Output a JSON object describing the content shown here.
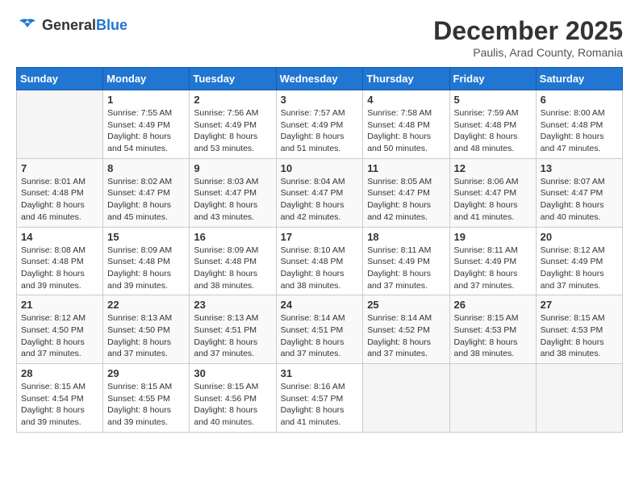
{
  "header": {
    "logo": {
      "general": "General",
      "blue": "Blue"
    },
    "title": "December 2025",
    "subtitle": "Paulis, Arad County, Romania"
  },
  "calendar": {
    "days_of_week": [
      "Sunday",
      "Monday",
      "Tuesday",
      "Wednesday",
      "Thursday",
      "Friday",
      "Saturday"
    ],
    "weeks": [
      [
        {
          "day": "",
          "info": ""
        },
        {
          "day": "1",
          "info": "Sunrise: 7:55 AM\nSunset: 4:49 PM\nDaylight: 8 hours\nand 54 minutes."
        },
        {
          "day": "2",
          "info": "Sunrise: 7:56 AM\nSunset: 4:49 PM\nDaylight: 8 hours\nand 53 minutes."
        },
        {
          "day": "3",
          "info": "Sunrise: 7:57 AM\nSunset: 4:49 PM\nDaylight: 8 hours\nand 51 minutes."
        },
        {
          "day": "4",
          "info": "Sunrise: 7:58 AM\nSunset: 4:48 PM\nDaylight: 8 hours\nand 50 minutes."
        },
        {
          "day": "5",
          "info": "Sunrise: 7:59 AM\nSunset: 4:48 PM\nDaylight: 8 hours\nand 48 minutes."
        },
        {
          "day": "6",
          "info": "Sunrise: 8:00 AM\nSunset: 4:48 PM\nDaylight: 8 hours\nand 47 minutes."
        }
      ],
      [
        {
          "day": "7",
          "info": "Sunrise: 8:01 AM\nSunset: 4:48 PM\nDaylight: 8 hours\nand 46 minutes."
        },
        {
          "day": "8",
          "info": "Sunrise: 8:02 AM\nSunset: 4:47 PM\nDaylight: 8 hours\nand 45 minutes."
        },
        {
          "day": "9",
          "info": "Sunrise: 8:03 AM\nSunset: 4:47 PM\nDaylight: 8 hours\nand 43 minutes."
        },
        {
          "day": "10",
          "info": "Sunrise: 8:04 AM\nSunset: 4:47 PM\nDaylight: 8 hours\nand 42 minutes."
        },
        {
          "day": "11",
          "info": "Sunrise: 8:05 AM\nSunset: 4:47 PM\nDaylight: 8 hours\nand 42 minutes."
        },
        {
          "day": "12",
          "info": "Sunrise: 8:06 AM\nSunset: 4:47 PM\nDaylight: 8 hours\nand 41 minutes."
        },
        {
          "day": "13",
          "info": "Sunrise: 8:07 AM\nSunset: 4:47 PM\nDaylight: 8 hours\nand 40 minutes."
        }
      ],
      [
        {
          "day": "14",
          "info": "Sunrise: 8:08 AM\nSunset: 4:48 PM\nDaylight: 8 hours\nand 39 minutes."
        },
        {
          "day": "15",
          "info": "Sunrise: 8:09 AM\nSunset: 4:48 PM\nDaylight: 8 hours\nand 39 minutes."
        },
        {
          "day": "16",
          "info": "Sunrise: 8:09 AM\nSunset: 4:48 PM\nDaylight: 8 hours\nand 38 minutes."
        },
        {
          "day": "17",
          "info": "Sunrise: 8:10 AM\nSunset: 4:48 PM\nDaylight: 8 hours\nand 38 minutes."
        },
        {
          "day": "18",
          "info": "Sunrise: 8:11 AM\nSunset: 4:49 PM\nDaylight: 8 hours\nand 37 minutes."
        },
        {
          "day": "19",
          "info": "Sunrise: 8:11 AM\nSunset: 4:49 PM\nDaylight: 8 hours\nand 37 minutes."
        },
        {
          "day": "20",
          "info": "Sunrise: 8:12 AM\nSunset: 4:49 PM\nDaylight: 8 hours\nand 37 minutes."
        }
      ],
      [
        {
          "day": "21",
          "info": "Sunrise: 8:12 AM\nSunset: 4:50 PM\nDaylight: 8 hours\nand 37 minutes."
        },
        {
          "day": "22",
          "info": "Sunrise: 8:13 AM\nSunset: 4:50 PM\nDaylight: 8 hours\nand 37 minutes."
        },
        {
          "day": "23",
          "info": "Sunrise: 8:13 AM\nSunset: 4:51 PM\nDaylight: 8 hours\nand 37 minutes."
        },
        {
          "day": "24",
          "info": "Sunrise: 8:14 AM\nSunset: 4:51 PM\nDaylight: 8 hours\nand 37 minutes."
        },
        {
          "day": "25",
          "info": "Sunrise: 8:14 AM\nSunset: 4:52 PM\nDaylight: 8 hours\nand 37 minutes."
        },
        {
          "day": "26",
          "info": "Sunrise: 8:15 AM\nSunset: 4:53 PM\nDaylight: 8 hours\nand 38 minutes."
        },
        {
          "day": "27",
          "info": "Sunrise: 8:15 AM\nSunset: 4:53 PM\nDaylight: 8 hours\nand 38 minutes."
        }
      ],
      [
        {
          "day": "28",
          "info": "Sunrise: 8:15 AM\nSunset: 4:54 PM\nDaylight: 8 hours\nand 39 minutes."
        },
        {
          "day": "29",
          "info": "Sunrise: 8:15 AM\nSunset: 4:55 PM\nDaylight: 8 hours\nand 39 minutes."
        },
        {
          "day": "30",
          "info": "Sunrise: 8:15 AM\nSunset: 4:56 PM\nDaylight: 8 hours\nand 40 minutes."
        },
        {
          "day": "31",
          "info": "Sunrise: 8:16 AM\nSunset: 4:57 PM\nDaylight: 8 hours\nand 41 minutes."
        },
        {
          "day": "",
          "info": ""
        },
        {
          "day": "",
          "info": ""
        },
        {
          "day": "",
          "info": ""
        }
      ]
    ]
  }
}
